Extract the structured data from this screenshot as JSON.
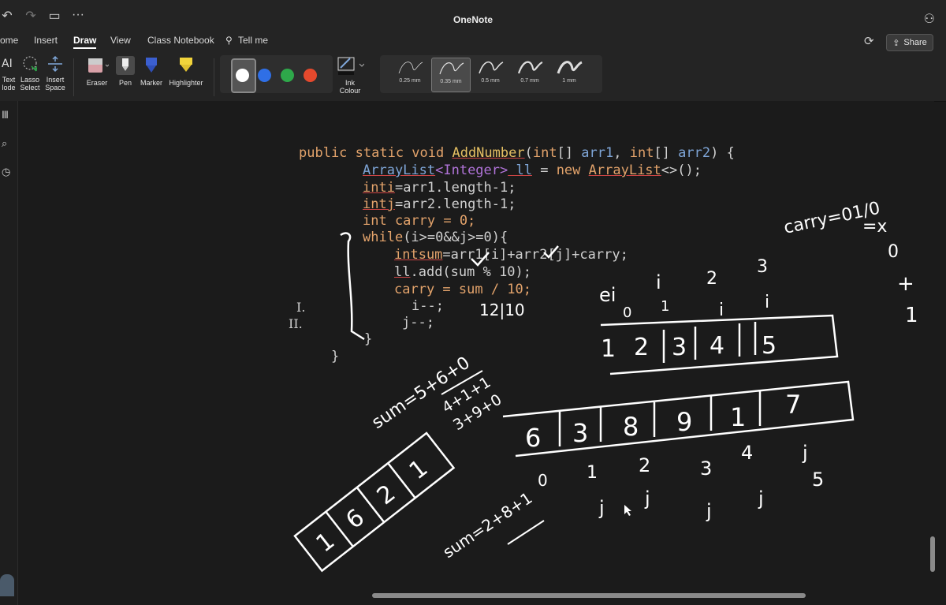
{
  "app": {
    "title": "OneNote"
  },
  "titlebar": {
    "undo": "↶",
    "redo": "↷",
    "folder": "▭",
    "more": "···"
  },
  "menu": {
    "home": "ome",
    "insert": "Insert",
    "draw": "Draw",
    "view": "View",
    "class_notebook": "Class Notebook",
    "tell_me": "Tell me"
  },
  "share": {
    "label": "Share"
  },
  "ribbon": {
    "text_mode": [
      "Text",
      "lode"
    ],
    "lasso": [
      "Lasso",
      "Select"
    ],
    "insert_space": [
      "Insert",
      "Space"
    ],
    "eraser": "Eraser",
    "pen": "Pen",
    "marker": "Marker",
    "highlighter": "Highlighter",
    "ink_colour": [
      "Ink",
      "Colour"
    ],
    "thicknesses": [
      "0.25 mm",
      "0.35 mm",
      "0.5 mm",
      "0.7 mm",
      "1 mm"
    ],
    "selected_thickness": "0.35 mm",
    "colors": [
      "#ffffff",
      "#2f6fe6",
      "#2ea84a",
      "#e5492d"
    ]
  },
  "code": {
    "line1_kw": "public static void ",
    "line1_fn": "AddNumber",
    "line1_p1": "(",
    "line1_t1": "int",
    "line1_p2": "[] ",
    "line1_a1": "arr1",
    "line1_p3": ", ",
    "line1_t2": "int",
    "line1_p4": "[] ",
    "line1_a2": "arr2",
    "line1_p5": ") {",
    "line2_t": "ArrayList",
    "line2_g": "<Integer>",
    "line2_v": " ll",
    "line2_r1": " = ",
    "line2_n": "new",
    "line2_r2": " ",
    "line2_c": "ArrayList",
    "line2_e": "<>();",
    "line3_k": "inti",
    "line3_r": "=arr1.length-1;",
    "line4_k": "intj",
    "line4_r": "=arr2.length-1;",
    "line5": "int carry = 0;",
    "line6_k": "while",
    "line6_r": "(i>=0&&j>=0){",
    "line7_k": "intsum",
    "line7_r": "=arr1[i]+arr2[j]+carry;",
    "line8_k": "ll",
    "line8_r": ".add(sum % 10);",
    "line9": "carry = sum / 10;",
    "line10": "i--;",
    "line11": "j--;",
    "line12": "}",
    "line13": "}",
    "roman1": "I.",
    "roman2": "II."
  },
  "ink": {
    "carry_note": "carry=01/0",
    "x_note": "=x",
    "zero_note": "0",
    "one_note": "1",
    "plus_note": "+",
    "sum_note": "12|10",
    "arr1_cells": [
      "1",
      "2",
      "3",
      "4",
      "5"
    ],
    "arr1_top_labels": [
      "ei",
      "i",
      "2",
      "3"
    ],
    "arr1_indices": [
      "0",
      "1",
      "i",
      "i"
    ],
    "arr2_cells": [
      "6",
      "3",
      "8",
      "9",
      "1",
      "7"
    ],
    "arr2_indices": [
      "0",
      "1",
      "2",
      "3",
      "4",
      "5"
    ],
    "j_labels": [
      "j",
      "j",
      "j",
      "j",
      "j"
    ],
    "result_cells": [
      "1",
      "6",
      "2",
      "1"
    ],
    "sum_eq": "sum=5+6+0",
    "sum2": "4+1+1",
    "sum3": "3+9+0",
    "sum4": "sum=2+8+1"
  }
}
